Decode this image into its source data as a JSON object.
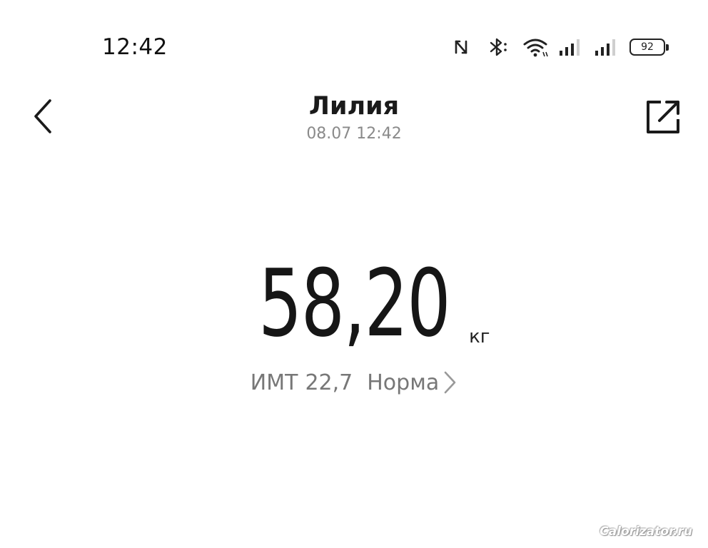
{
  "status_bar": {
    "time": "12:42",
    "battery": "92",
    "icons": [
      "nfc-icon",
      "bluetooth-icon",
      "wifi-icon",
      "signal-icon",
      "signal-icon"
    ]
  },
  "header": {
    "title": "Лилия",
    "subtitle": "08.07 12:42",
    "back_icon": "chevron-left-icon",
    "share_icon": "share-external-icon"
  },
  "measurement": {
    "weight": "58,20",
    "unit": "кг",
    "bmi_label": "ИМТ",
    "bmi_value": "22,7",
    "bmi_status": "Норма"
  },
  "watermark": "Calorizator.ru",
  "colors": {
    "background": "#ffffff",
    "primary_text": "#161616",
    "secondary_text": "#8a8a8a"
  }
}
